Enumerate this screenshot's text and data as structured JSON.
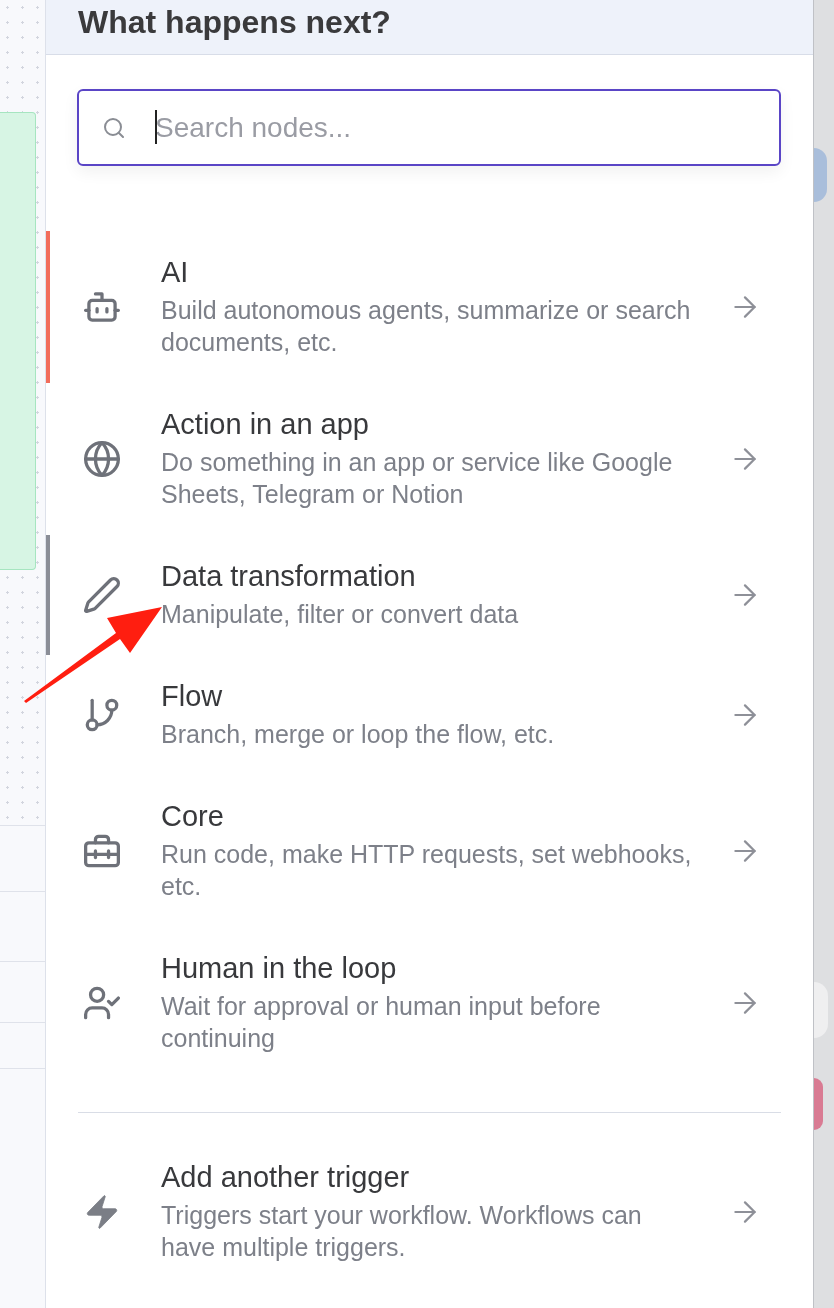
{
  "panel": {
    "title": "What happens next?"
  },
  "search": {
    "placeholder": "Search nodes...",
    "focused": true
  },
  "sections": [
    {
      "items": [
        {
          "kind": "ai",
          "title": "AI",
          "description": "Build autonomous agents, summarize or search documents, etc.",
          "selected": false
        },
        {
          "kind": "action",
          "title": "Action in an app",
          "description": "Do something in an app or service like Google Sheets, Telegram or Notion",
          "selected": false
        },
        {
          "kind": "transform",
          "title": "Data transformation",
          "description": "Manipulate, filter or convert data",
          "selected": true
        },
        {
          "kind": "flow",
          "title": "Flow",
          "description": "Branch, merge or loop the flow, etc.",
          "selected": false
        },
        {
          "kind": "core",
          "title": "Core",
          "description": "Run code, make HTTP requests, set webhooks, etc.",
          "selected": false
        },
        {
          "kind": "human",
          "title": "Human in the loop",
          "description": "Wait for approval or human input before continuing",
          "selected": false
        }
      ]
    },
    {
      "items": [
        {
          "kind": "trigger",
          "title": "Add another trigger",
          "description": "Triggers start your workflow. Workflows can have multiple triggers.",
          "selected": false
        }
      ]
    }
  ]
}
